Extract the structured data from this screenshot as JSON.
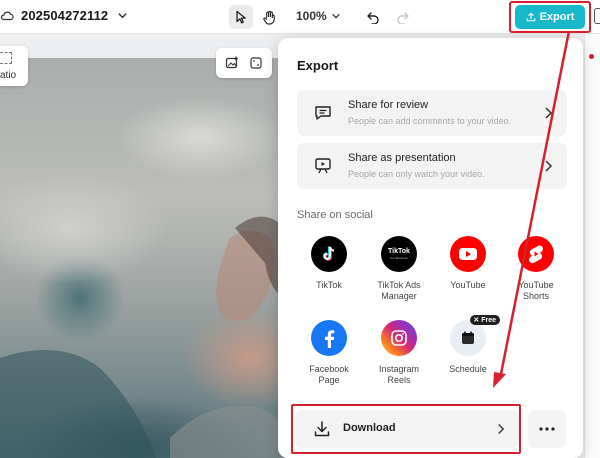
{
  "topbar": {
    "project_name": "202504272112",
    "zoom_label": "100%",
    "export_label": "Export"
  },
  "canvas": {
    "ratio_label": "atio"
  },
  "export_panel": {
    "title": "Export",
    "share_review": {
      "title": "Share for review",
      "subtitle": "People can add comments to your video."
    },
    "share_presentation": {
      "title": "Share as presentation",
      "subtitle": "People can only watch your video."
    },
    "social_label": "Share on social",
    "social": [
      {
        "label": "TikTok",
        "icon": "tiktok-icon",
        "color": "#000000"
      },
      {
        "label": "TikTok Ads Manager",
        "icon": "tiktok-ads-icon",
        "color": "#000000",
        "logo_text": "TikTok",
        "logo_sub": "For Business"
      },
      {
        "label": "YouTube",
        "icon": "youtube-icon",
        "color": "#ff0000"
      },
      {
        "label": "YouTube Shorts",
        "icon": "youtube-shorts-icon",
        "color": "#ff0000"
      },
      {
        "label": "Facebook Page",
        "icon": "facebook-icon",
        "color": "#1877f2"
      },
      {
        "label": "Instagram Reels",
        "icon": "instagram-icon",
        "color": "#d62976"
      },
      {
        "label": "Schedule",
        "icon": "schedule-icon",
        "color": "#e8eef3",
        "badge": "Free"
      }
    ],
    "download_label": "Download"
  },
  "colors": {
    "accent": "#17b8c9",
    "highlight": "#d6202f"
  }
}
